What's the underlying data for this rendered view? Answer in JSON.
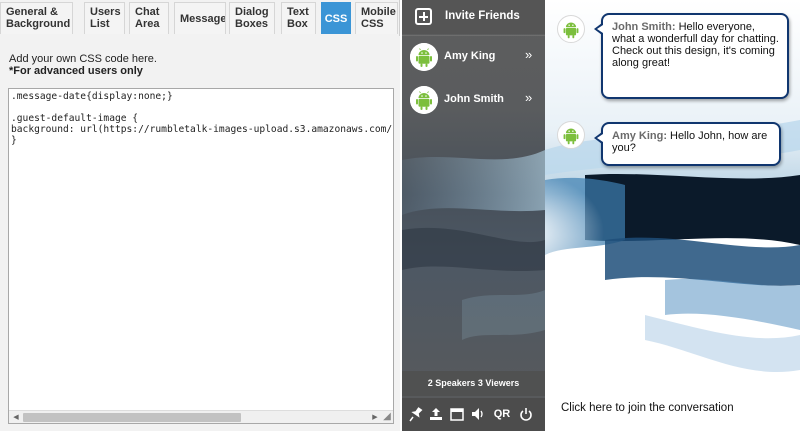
{
  "tabs": [
    {
      "id": "general",
      "label": "General &\nBackground",
      "active": false
    },
    {
      "id": "users",
      "label": "Users\nList",
      "active": false
    },
    {
      "id": "chat",
      "label": "Chat\nArea",
      "active": false
    },
    {
      "id": "message",
      "label": "Message",
      "active": false
    },
    {
      "id": "dialog",
      "label": "Dialog\nBoxes",
      "active": false
    },
    {
      "id": "textbox",
      "label": "Text\nBox",
      "active": false
    },
    {
      "id": "css",
      "label": "CSS",
      "active": true
    },
    {
      "id": "mobile",
      "label": "Mobile\nCSS",
      "active": false
    }
  ],
  "editor": {
    "instruction_line1": "Add your own CSS code here.",
    "instruction_line2": "*For advanced users only",
    "code": ".message-date{display:none;}\n\n.guest-default-image {\nbackground: url(https://rumbletalk-images-upload.s3.amazonaws.com/\n}"
  },
  "sidebar": {
    "invite_label": "Invite Friends",
    "users": [
      {
        "name": "Amy King"
      },
      {
        "name": "John Smith"
      }
    ],
    "stats": {
      "speakers_count": "2",
      "speakers_label": "Speakers",
      "viewers_count": "3",
      "viewers_label": "Viewers"
    },
    "toolbar": [
      {
        "icon": "pin-icon"
      },
      {
        "icon": "upload-icon"
      },
      {
        "icon": "window-icon"
      },
      {
        "icon": "volume-icon"
      },
      {
        "icon": "qr-icon",
        "label": "QR"
      },
      {
        "icon": "power-icon"
      }
    ]
  },
  "chat": {
    "messages": [
      {
        "author": "John Smith:",
        "text": "Hello everyone, what a wonderfull day for chatting.\nCheck out this design, it's coming along great!"
      },
      {
        "author": "Amy King:",
        "text": "Hello John, how are you?"
      }
    ],
    "join_text": "Click here to join the conversation"
  },
  "colors": {
    "active_tab": "#3b95d6",
    "bubble_border": "#10366f",
    "sidebar_bg": "#5a5a5a"
  }
}
